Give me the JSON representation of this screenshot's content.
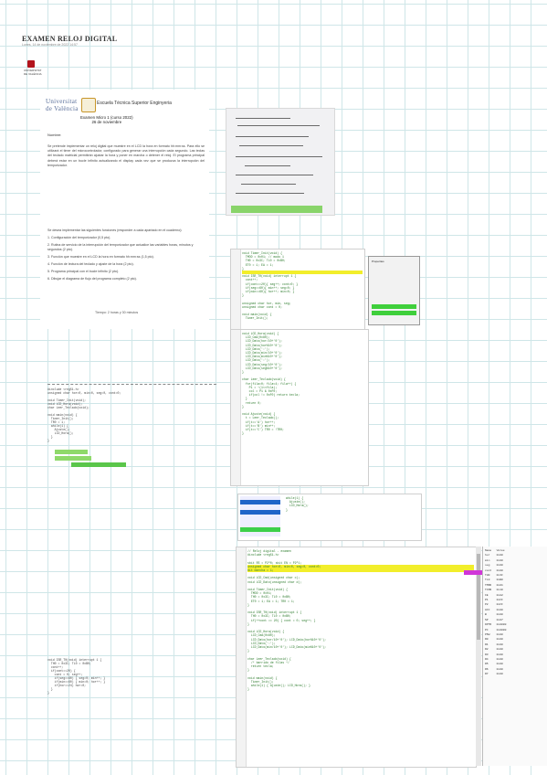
{
  "header": {
    "title": "EXAMEN RELOJ DIGITAL",
    "subtitle": "Lunes, 14 de noviembre de 2022   14:57"
  },
  "exam": {
    "univ_line1": "Universitat",
    "univ_line2": "de València",
    "escuela": "Escuela Técnica Superior Enginyeria",
    "heading_line1": "Examen Micro 1 (curso 2022)",
    "heading_line2": "26 de noviembre",
    "nombre_label": "Nombre:",
    "paragraph": "Se pretende implementar un reloj digital que muestre en el LCD la hora en formato hh:mm:ss. Para ello se utilizará el timer del microcontrolador, configurado para generar una interrupción cada segundo. Las teclas del teclado matricial permitirán ajustar la hora y poner en marcha o detener el reloj. El programa principal deberá estar en un bucle infinito actualizando el display cada vez que se produzca la interrupción del temporizador.",
    "intro_list": "Se desea implementar las siguientes funciones (responder a cada apartado en el cuaderno):",
    "items": [
      "1.  Configuración del temporizador (0,5 pto).",
      "2.  Rutina de servicio de la interrupción del temporizador que actualice las variables horas, minutos y segundos (2 pto).",
      "3.  Función que muestre en el LCD la hora en formato hh:mm:ss (1,5 pto).",
      "4.  Función de lectura del teclado y ajuste de la hora (2 pto).",
      "5.  Programa principal con el bucle infinito (2 pto).",
      "6.  Dibujar el diagrama de flujo del programa completo (2 pto)."
    ],
    "footer": "Tiempo: 2 horas y 30 minutos"
  }
}
